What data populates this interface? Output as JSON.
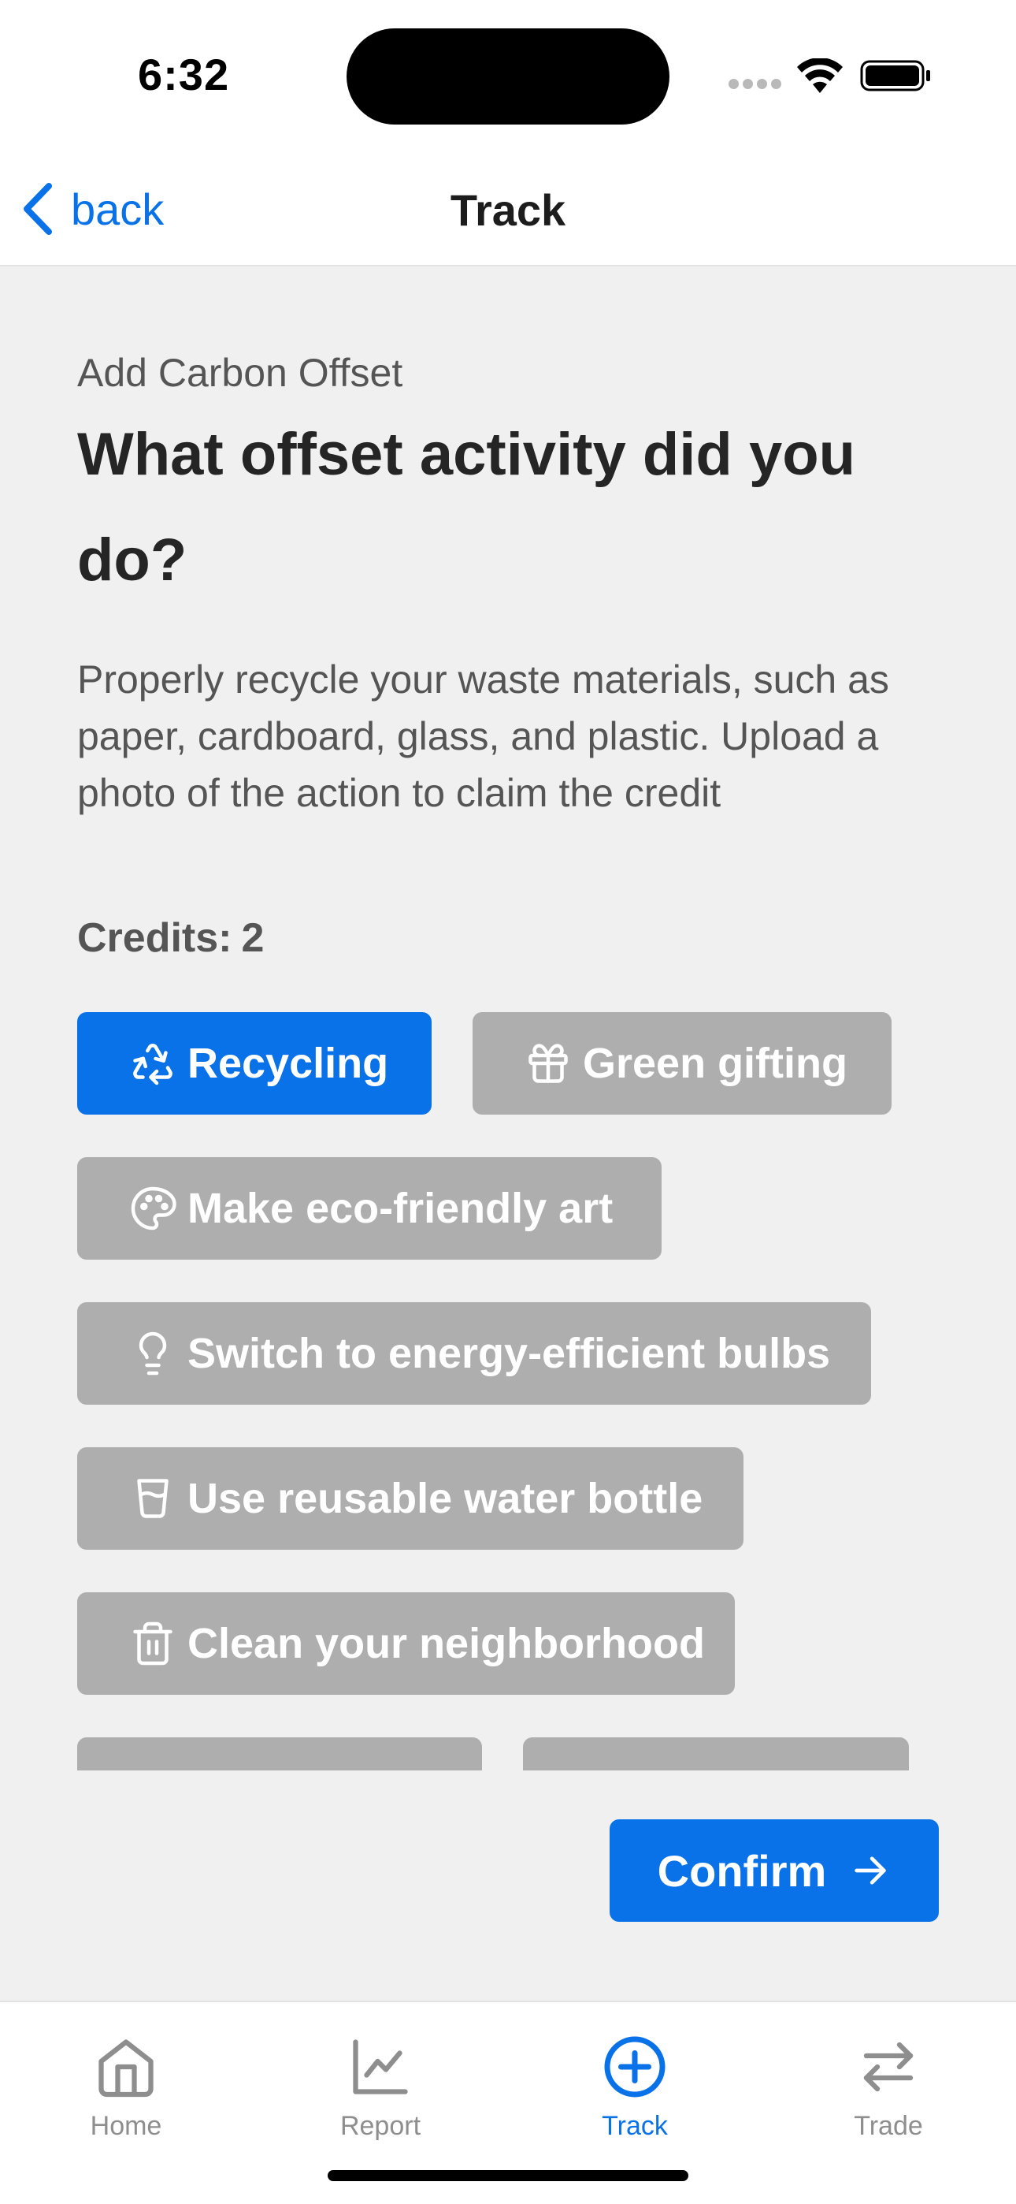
{
  "status_bar": {
    "time": "6:32"
  },
  "nav": {
    "back_label": "back",
    "title": "Track"
  },
  "content": {
    "subtitle": "Add Carbon Offset",
    "heading": "What offset activity did you do?",
    "description": "Properly recycle your waste materials, such as paper, cardboard, glass, and plastic. Upload a photo of the action to claim the credit",
    "credits_label": "Credits:",
    "credits_value": "2"
  },
  "activities": [
    {
      "label": "Recycling",
      "icon": "recycle-icon",
      "selected": true
    },
    {
      "label": "Green gifting",
      "icon": "gift-icon",
      "selected": false
    },
    {
      "label": "Make eco-friendly art",
      "icon": "palette-icon",
      "selected": false
    },
    {
      "label": "Switch to energy-efficient bulbs",
      "icon": "lightbulb-icon",
      "selected": false
    },
    {
      "label": "Use reusable water bottle",
      "icon": "cup-icon",
      "selected": false
    },
    {
      "label": "Clean your neighborhood",
      "icon": "trash-icon",
      "selected": false
    },
    {
      "label": "",
      "icon": "",
      "selected": false
    },
    {
      "label": "",
      "icon": "",
      "selected": false
    }
  ],
  "confirm_label": "Confirm",
  "tabs": [
    {
      "label": "Home",
      "icon": "home-icon",
      "active": false
    },
    {
      "label": "Report",
      "icon": "chart-icon",
      "active": false
    },
    {
      "label": "Track",
      "icon": "plus-circle-icon",
      "active": true
    },
    {
      "label": "Trade",
      "icon": "swap-arrows-icon",
      "active": false
    }
  ],
  "colors": {
    "accent": "#0a72e8",
    "chip_inactive": "#aeaeae",
    "background": "#f0f0f0"
  }
}
